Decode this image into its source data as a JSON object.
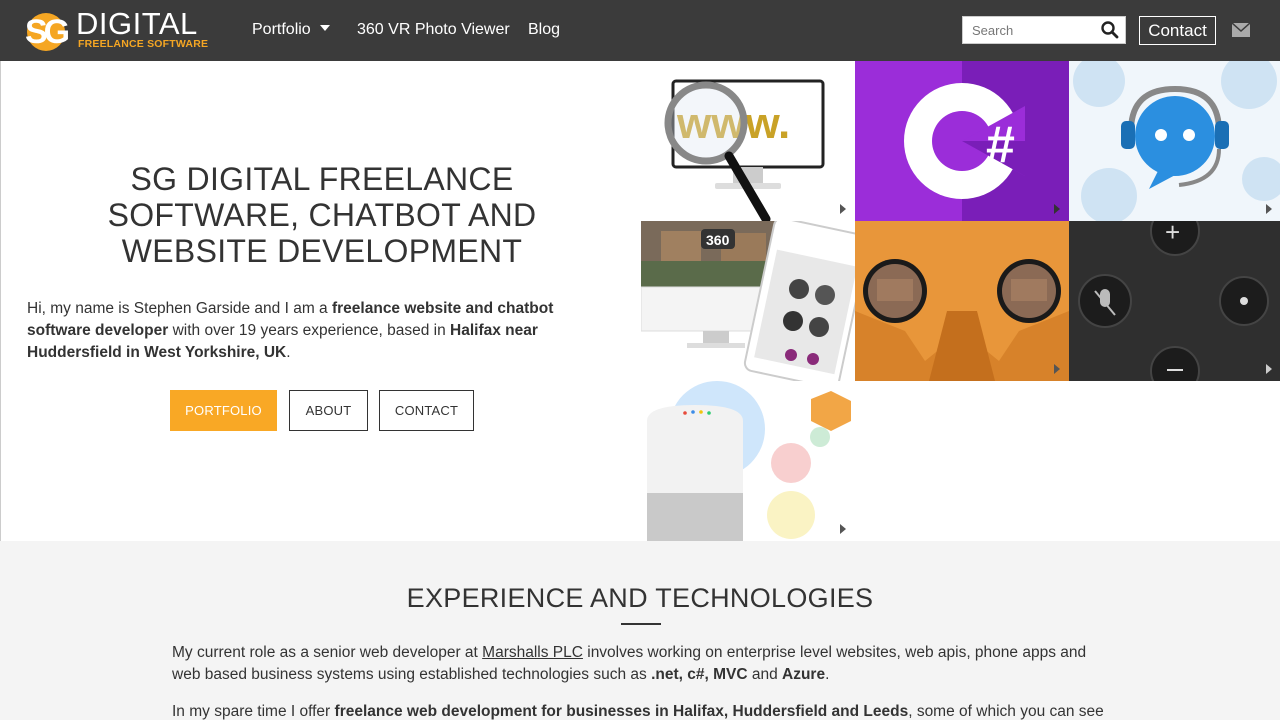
{
  "nav": {
    "logo_word": "DIGITAL",
    "logo_tag": "FREELANCE SOFTWARE",
    "links": [
      {
        "label": "Portfolio"
      },
      {
        "label": "360 VR Photo Viewer"
      },
      {
        "label": "Blog"
      }
    ],
    "search_placeholder": "Search",
    "contact_label": "Contact",
    "colors": {
      "bar": "#3b3b3b",
      "accent": "#f5a623"
    }
  },
  "hero": {
    "title": "SG DIGITAL FREELANCE SOFTWARE, CHATBOT AND WEBSITE DEVELOPMENT",
    "intro": {
      "t1": "Hi, my name is Stephen Garside and I am a ",
      "b1": "freelance website and chatbot software developer",
      "t2": " with over 19 years experience, based in ",
      "b2": "Halifax near Huddersfield in West Yorkshire, UK",
      "t3": "."
    },
    "buttons": {
      "portfolio": "PORTFOLIO",
      "about": "ABOUT",
      "contact": "CONTACT"
    },
    "colors": {
      "portfolio_button": "#f9a825"
    }
  },
  "tiles": [
    {
      "name": "www-search-tile",
      "icon": "magnifier-monitor-icon",
      "text": "www."
    },
    {
      "name": "csharp-tile",
      "icon": "csharp-logo-icon",
      "text": "#"
    },
    {
      "name": "chatbot-tile",
      "icon": "chatbot-headset-icon"
    },
    {
      "name": "property-site-tile",
      "icon": "website-screens-icon",
      "text": "360"
    },
    {
      "name": "vr-viewer-tile",
      "icon": "vr-headset-icon"
    },
    {
      "name": "voice-assistant-tile",
      "icon": "microphone-icon",
      "text": "+"
    },
    {
      "name": "google-home-tile",
      "icon": "smart-speaker-icon"
    }
  ],
  "experience": {
    "title": "EXPERIENCE AND TECHNOLOGIES",
    "p1": {
      "t1": "My current role as a senior web developer at ",
      "link": "Marshalls PLC",
      "t2": " involves working on enterprise level websites, web apis, phone apps and web based business systems using established technologies such as ",
      "b1": ".net, c#, MVC",
      "t3": " and ",
      "b2": "Azure",
      "t4": "."
    },
    "p2": {
      "t1": "In my spare time I offer ",
      "b1": "freelance web development for businesses in Halifax, Huddersfield and Leeds",
      "t2": ", some of which you can see"
    }
  }
}
